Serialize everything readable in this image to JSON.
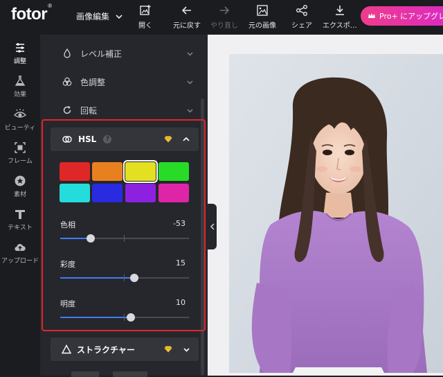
{
  "header": {
    "logo": "fotor",
    "logo_mark": "®",
    "edit_menu": "画像編集",
    "tools": [
      {
        "label": "開く",
        "icon": "open-image-icon",
        "enabled": true
      },
      {
        "label": "元に戻す",
        "icon": "undo-arrow-icon",
        "enabled": true
      },
      {
        "label": "やり直し",
        "icon": "redo-arrow-icon",
        "enabled": false
      },
      {
        "label": "元の画像",
        "icon": "original-image-icon",
        "enabled": true
      },
      {
        "label": "シェア",
        "icon": "share-icon",
        "enabled": true
      },
      {
        "label": "エクスポ…",
        "icon": "download-icon",
        "enabled": true
      }
    ],
    "pro_button": "Pro+ にアップグレード"
  },
  "sidebar": {
    "items": [
      {
        "label": "調整",
        "icon": "sliders-icon",
        "active": true
      },
      {
        "label": "効果",
        "icon": "flask-icon",
        "active": false
      },
      {
        "label": "ビューティ",
        "icon": "eye-icon",
        "active": false
      },
      {
        "label": "フレーム",
        "icon": "frame-icon",
        "active": false
      },
      {
        "label": "素材",
        "icon": "star-badge-icon",
        "active": false
      },
      {
        "label": "テキスト",
        "icon": "text-t-icon",
        "active": false
      },
      {
        "label": "アップロード",
        "icon": "cloud-upload-icon",
        "active": false
      }
    ]
  },
  "panel": {
    "sections": [
      {
        "label": "レベル補正",
        "icon": "droplet-icon"
      },
      {
        "label": "色調整",
        "icon": "color-circles-icon"
      },
      {
        "label": "回転",
        "icon": "rotate-icon"
      }
    ],
    "hsl": {
      "title": "HSL",
      "help": "?",
      "swatches": [
        {
          "name": "red",
          "color": "#e02727",
          "selected": false
        },
        {
          "name": "orange",
          "color": "#e9801f",
          "selected": false
        },
        {
          "name": "yellow",
          "color": "#e3e021",
          "selected": true
        },
        {
          "name": "green",
          "color": "#27db27",
          "selected": false
        },
        {
          "name": "cyan",
          "color": "#25dcdc",
          "selected": false
        },
        {
          "name": "blue",
          "color": "#2a2ae0",
          "selected": false
        },
        {
          "name": "purple",
          "color": "#8c22e0",
          "selected": false
        },
        {
          "name": "magenta",
          "color": "#df25a7",
          "selected": false
        }
      ],
      "sliders": [
        {
          "label": "色相",
          "value": "-53",
          "level": -53
        },
        {
          "label": "彩度",
          "value": "15",
          "level": 15
        },
        {
          "label": "明度",
          "value": "10",
          "level": 10
        }
      ]
    },
    "structure": {
      "label": "ストラクチャー"
    }
  },
  "colors": {
    "accent_blue": "#3f7cf5",
    "highlight_red": "#e0262c",
    "premium_gold": "#f0c330"
  }
}
